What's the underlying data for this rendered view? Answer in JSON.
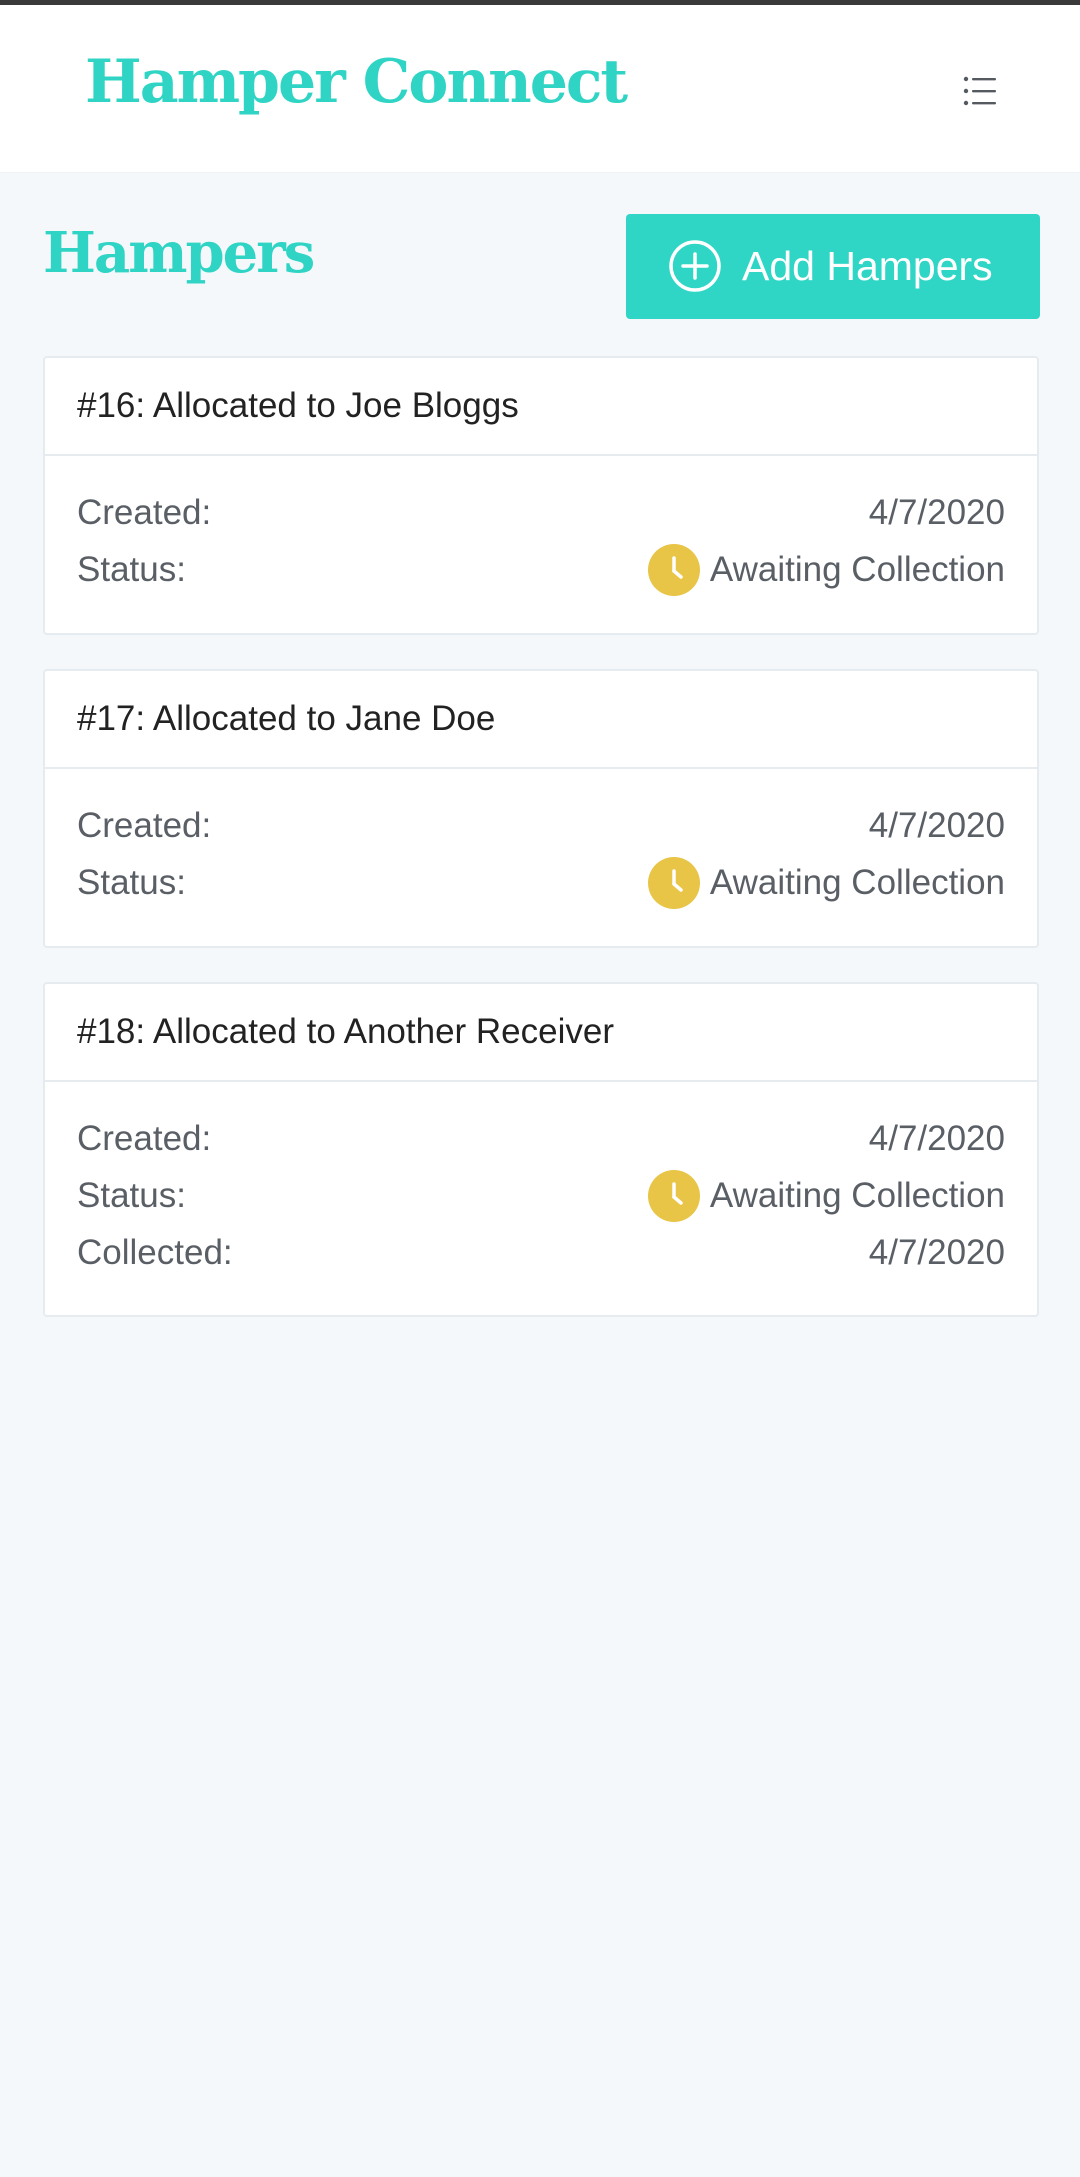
{
  "app": {
    "brand": "Hamper Connect"
  },
  "icons": {
    "menu": "list-menu-icon",
    "add": "plus-circle-icon",
    "status": "clock-icon"
  },
  "colors": {
    "brand": "#2fd4c4",
    "button": "#2fd6c6",
    "status_awaiting": "#e8c547"
  },
  "page": {
    "title": "Hampers",
    "add_button_label": "Add Hampers"
  },
  "hampers": [
    {
      "title": "#16: Allocated to Joe Bloggs",
      "created_label": "Created:",
      "created": "4/7/2020",
      "status_label": "Status:",
      "status": "Awaiting Collection"
    },
    {
      "title": "#17: Allocated to Jane Doe",
      "created_label": "Created:",
      "created": "4/7/2020",
      "status_label": "Status:",
      "status": "Awaiting Collection"
    },
    {
      "title": "#18: Allocated to Another Receiver",
      "created_label": "Created:",
      "created": "4/7/2020",
      "status_label": "Status:",
      "status": "Awaiting Collection",
      "collected_label": "Collected:",
      "collected": "4/7/2020"
    }
  ]
}
